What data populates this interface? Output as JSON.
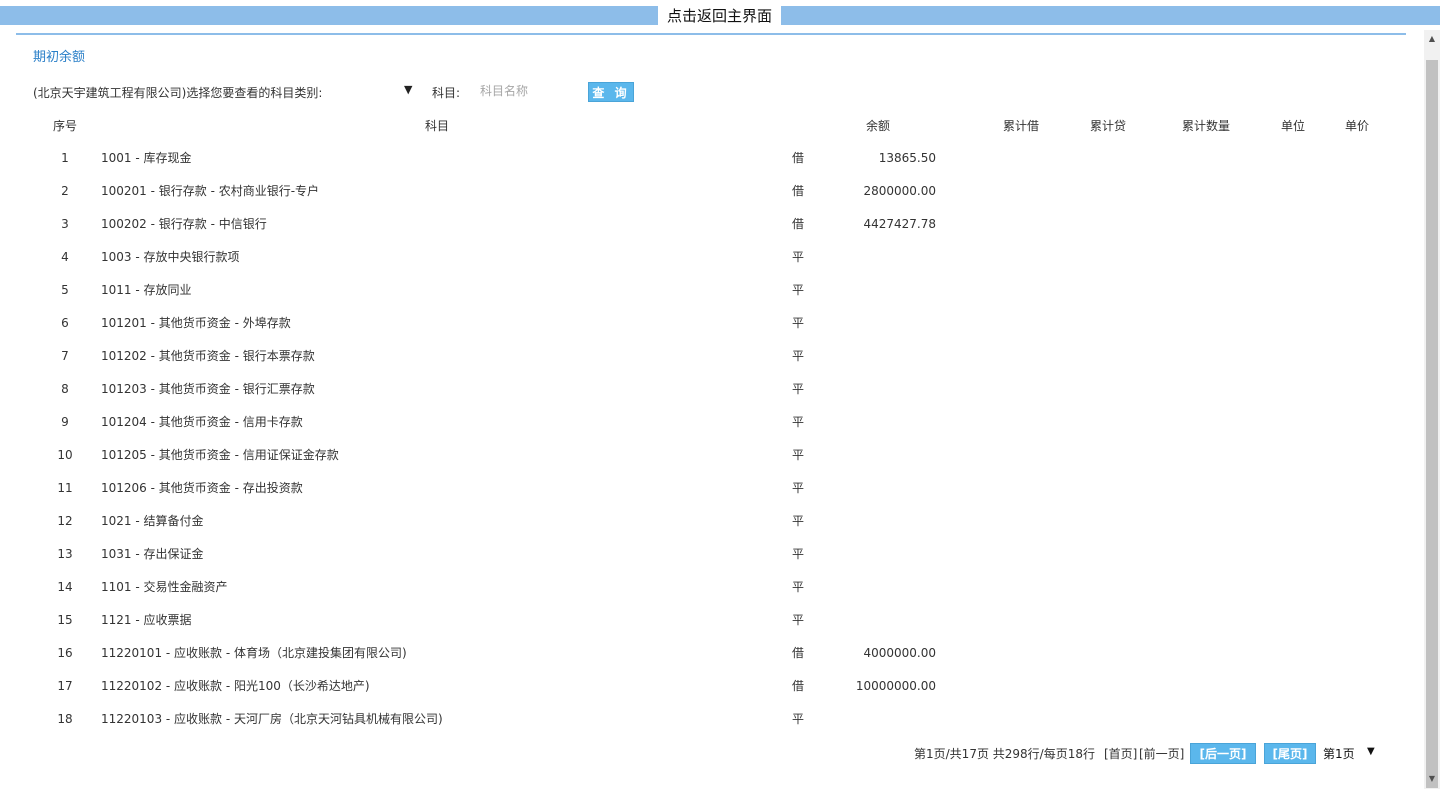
{
  "header": {
    "back_label": "点击返回主界面"
  },
  "section": {
    "title": "期初余额"
  },
  "filter": {
    "category_label": "(北京天宇建筑工程有限公司)选择您要查看的科目类别:",
    "subject_label": "科目:",
    "subject_placeholder": "科目名称",
    "query_label": "查 询"
  },
  "table": {
    "headers": {
      "no": "序号",
      "subject": "科目",
      "balance": "余额",
      "debit": "累计借",
      "credit": "累计贷",
      "qty": "累计数量",
      "unit": "单位",
      "price": "单价"
    },
    "rows": [
      {
        "no": "1",
        "subject": "1001 - 库存现金",
        "dir": "借",
        "balance": "13865.50"
      },
      {
        "no": "2",
        "subject": "100201 - 银行存款 - 农村商业银行-专户",
        "dir": "借",
        "balance": "2800000.00"
      },
      {
        "no": "3",
        "subject": "100202 - 银行存款 - 中信银行",
        "dir": "借",
        "balance": "4427427.78"
      },
      {
        "no": "4",
        "subject": "1003 - 存放中央银行款项",
        "dir": "平",
        "balance": ""
      },
      {
        "no": "5",
        "subject": "1011 - 存放同业",
        "dir": "平",
        "balance": ""
      },
      {
        "no": "6",
        "subject": "101201 - 其他货币资金 - 外埠存款",
        "dir": "平",
        "balance": ""
      },
      {
        "no": "7",
        "subject": "101202 - 其他货币资金 - 银行本票存款",
        "dir": "平",
        "balance": ""
      },
      {
        "no": "8",
        "subject": "101203 - 其他货币资金 - 银行汇票存款",
        "dir": "平",
        "balance": ""
      },
      {
        "no": "9",
        "subject": "101204 - 其他货币资金 - 信用卡存款",
        "dir": "平",
        "balance": ""
      },
      {
        "no": "10",
        "subject": "101205 - 其他货币资金 - 信用证保证金存款",
        "dir": "平",
        "balance": ""
      },
      {
        "no": "11",
        "subject": "101206 - 其他货币资金 - 存出投资款",
        "dir": "平",
        "balance": ""
      },
      {
        "no": "12",
        "subject": "1021 - 结算备付金",
        "dir": "平",
        "balance": ""
      },
      {
        "no": "13",
        "subject": "1031 - 存出保证金",
        "dir": "平",
        "balance": ""
      },
      {
        "no": "14",
        "subject": "1101 - 交易性金融资产",
        "dir": "平",
        "balance": ""
      },
      {
        "no": "15",
        "subject": "1121 - 应收票据",
        "dir": "平",
        "balance": ""
      },
      {
        "no": "16",
        "subject": "11220101 - 应收账款 - 体育场（北京建投集团有限公司)",
        "dir": "借",
        "balance": "4000000.00"
      },
      {
        "no": "17",
        "subject": "11220102 - 应收账款 - 阳光100（长沙希达地产)",
        "dir": "借",
        "balance": "10000000.00"
      },
      {
        "no": "18",
        "subject": "11220103 - 应收账款 - 天河厂房（北京天河钻具机械有限公司)",
        "dir": "平",
        "balance": ""
      }
    ]
  },
  "pager": {
    "summary": "第1页/共17页  共298行/每页18行",
    "first": "[首页]",
    "prev": "[前一页]",
    "next": "[后一页]",
    "last": "[尾页]",
    "current": "第1页"
  }
}
